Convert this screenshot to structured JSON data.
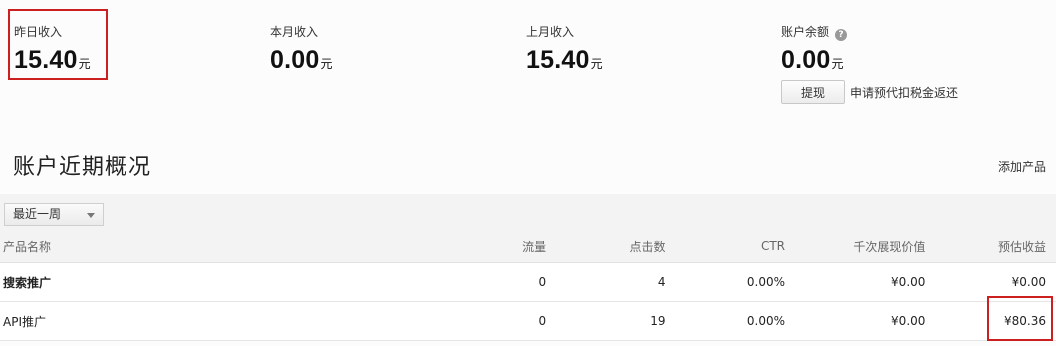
{
  "stats": [
    {
      "label": "昨日收入",
      "value": "15.40",
      "unit": "元",
      "highlighted": true
    },
    {
      "label": "本月收入",
      "value": "0.00",
      "unit": "元"
    },
    {
      "label": "上月收入",
      "value": "15.40",
      "unit": "元"
    },
    {
      "label": "账户余额",
      "value": "0.00",
      "unit": "元",
      "help_icon": "?"
    }
  ],
  "withdraw": {
    "button_label": "提现",
    "link_text": "申请预代扣税金返还"
  },
  "section": {
    "title": "账户近期概况",
    "add_product_label": "添加产品"
  },
  "filter": {
    "selected": "最近一周"
  },
  "table": {
    "columns": [
      "产品名称",
      "流量",
      "点击数",
      "CTR",
      "千次展现价值",
      "预估收益"
    ],
    "rows": [
      [
        "搜索推广",
        "0",
        "4",
        "0.00%",
        "¥0.00",
        "¥0.00"
      ],
      [
        "API推广",
        "0",
        "19",
        "0.00%",
        "¥0.00",
        "¥80.36"
      ]
    ]
  },
  "colors": {
    "highlight": "#cc1f1f"
  }
}
